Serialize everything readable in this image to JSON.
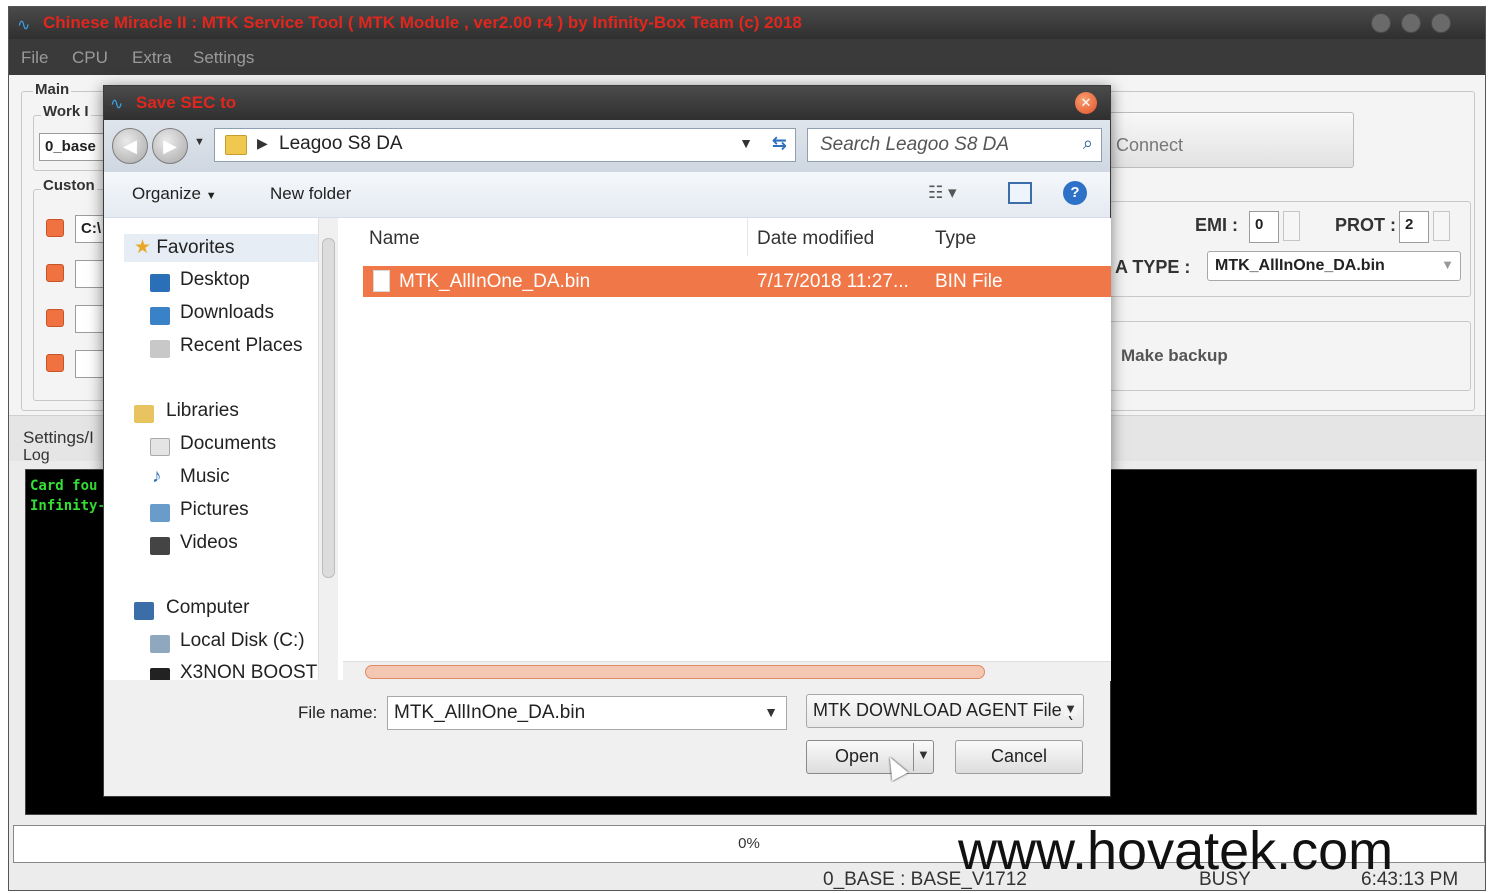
{
  "app": {
    "title": "Chinese Miracle II : MTK Service Tool ( MTK Module , ver2.00 r4 ) by Infinity-Box Team (c) 2018",
    "menu": [
      "File",
      "CPU",
      "Extra",
      "Settings"
    ]
  },
  "main": {
    "main_label": "Main",
    "work_label": "Work I",
    "work_value": "0_base",
    "custom_label": "Custon",
    "custom_path": "C:\\",
    "connect_label": "Connect",
    "emi_label": "EMI :",
    "emi_value": "0",
    "prot_label": "PROT :",
    "prot_value": "2",
    "da_type_label": "A TYPE :",
    "da_type_value": "MTK_AllInOne_DA.bin",
    "make_backup_label": "Make backup",
    "settings_tab": "Settings/I",
    "log_label": "Log",
    "log_lines": [
      "Card fou",
      "Infinity-"
    ]
  },
  "dialog": {
    "title": "Save SEC to",
    "breadcrumb": "Leagoo S8 DA",
    "search_placeholder": "Search Leagoo S8 DA",
    "organize": "Organize",
    "new_folder": "New folder",
    "nav": {
      "favorites": "Favorites",
      "desktop": "Desktop",
      "downloads": "Downloads",
      "recent": "Recent Places",
      "libraries": "Libraries",
      "documents": "Documents",
      "music": "Music",
      "pictures": "Pictures",
      "videos": "Videos",
      "computer": "Computer",
      "local_disk": "Local Disk (C:)",
      "x3non": "X3NON BOOST"
    },
    "columns": {
      "name": "Name",
      "date": "Date modified",
      "type": "Type"
    },
    "files": [
      {
        "name": "MTK_AllInOne_DA.bin",
        "date": "7/17/2018 11:27...",
        "type": "BIN File"
      }
    ],
    "file_name_label": "File name:",
    "file_name_value": "MTK_AllInOne_DA.bin",
    "file_type_value": "MTK DOWNLOAD AGENT File (",
    "open_label": "Open",
    "cancel_label": "Cancel"
  },
  "status": {
    "progress": "0%",
    "base": "0_BASE : BASE_V1712",
    "state": "BUSY",
    "time": "6:43:13 PM"
  },
  "watermark": "www.hovatek.com",
  "colors": {
    "title_red": "#e0261d",
    "selection_orange": "#f07848",
    "checkbox_orange": "#f07240",
    "log_green": "#35e035"
  }
}
